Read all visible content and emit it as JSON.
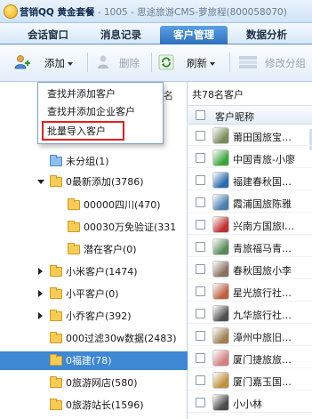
{
  "window": {
    "title_main": "营销QQ 黄金套餐",
    "title_sub": "- 1005 - 思途旅游CMS-萝旅程(800058070)"
  },
  "tabs": [
    {
      "label": "会话窗口",
      "active": false
    },
    {
      "label": "消息记录",
      "active": false
    },
    {
      "label": "客户管理",
      "active": true
    },
    {
      "label": "数据分析",
      "active": false
    }
  ],
  "toolbar": {
    "add_label": "添加",
    "delete_label": "删除",
    "refresh_label": "刷新",
    "edit_group_label": "修改分组"
  },
  "add_menu": {
    "items": [
      "查找并添加客户",
      "查找并添加企业客户",
      "批量导入客户"
    ],
    "highlighted_index": 2
  },
  "left_column_fragment": "名",
  "tree": [
    {
      "label": "未分组(1)",
      "level": 0,
      "arrow": "none",
      "folder": "blue",
      "selected": false
    },
    {
      "label": "0最新添加(3786)",
      "level": 0,
      "arrow": "down",
      "folder": "yellow",
      "selected": false
    },
    {
      "label": "00000四川(470)",
      "level": 1,
      "arrow": "none",
      "folder": "yellow",
      "selected": false
    },
    {
      "label": "00030万免验证(331",
      "level": 1,
      "arrow": "none",
      "folder": "yellow",
      "selected": false
    },
    {
      "label": "潜在客户(0)",
      "level": 1,
      "arrow": "none",
      "folder": "yellow",
      "selected": false
    },
    {
      "label": "小米客户(1474)",
      "level": 0,
      "arrow": "right",
      "folder": "yellow",
      "selected": false
    },
    {
      "label": "小平客户(0)",
      "level": 0,
      "arrow": "right",
      "folder": "yellow",
      "selected": false
    },
    {
      "label": "小乔客户(392)",
      "level": 0,
      "arrow": "right",
      "folder": "yellow",
      "selected": false
    },
    {
      "label": "000过滤30w数据(2483)",
      "level": 0,
      "arrow": "none",
      "folder": "yellow",
      "selected": false
    },
    {
      "label": "0福建(78)",
      "level": 0,
      "arrow": "none",
      "folder": "yellow",
      "selected": true
    },
    {
      "label": "0旅游网店(580)",
      "level": 0,
      "arrow": "none",
      "folder": "yellow",
      "selected": false
    },
    {
      "label": "0旅游站长(1596)",
      "level": 0,
      "arrow": "none",
      "folder": "yellow",
      "selected": false
    }
  ],
  "customers": {
    "count_label": "共78名客户",
    "column_header": "客户昵称",
    "rows": [
      {
        "name": "莆田国旅宝…",
        "avatar_color": "#7a8a5a"
      },
      {
        "name": "中国青旅-小廖",
        "avatar_color": "#3aa63a"
      },
      {
        "name": "福建春秋国…",
        "avatar_color": "#2b6cb0"
      },
      {
        "name": "霞浦国旅陈雅",
        "avatar_color": "#4a7fb0"
      },
      {
        "name": "兴南方国旅l…",
        "avatar_color": "#c03030"
      },
      {
        "name": "青旅福马青…",
        "avatar_color": "#5a8a5a"
      },
      {
        "name": "春秋国旅小李",
        "avatar_color": "#8a7060"
      },
      {
        "name": "星光旅行社…",
        "avatar_color": "#c06040"
      },
      {
        "name": "九华旅行社…",
        "avatar_color": "#505050"
      },
      {
        "name": "漳州中旅旧…",
        "avatar_color": "#a08050"
      },
      {
        "name": "厦门捷旅旅…",
        "avatar_color": "#d08080"
      },
      {
        "name": "厦门嘉玉国…",
        "avatar_color": "#c09040"
      },
      {
        "name": "小小林",
        "avatar_color": "#4a4a4a"
      }
    ]
  },
  "colors": {
    "active_tab": "#2d6fbd",
    "selected_row": "#3d87d3",
    "highlight_box": "#e02020"
  }
}
